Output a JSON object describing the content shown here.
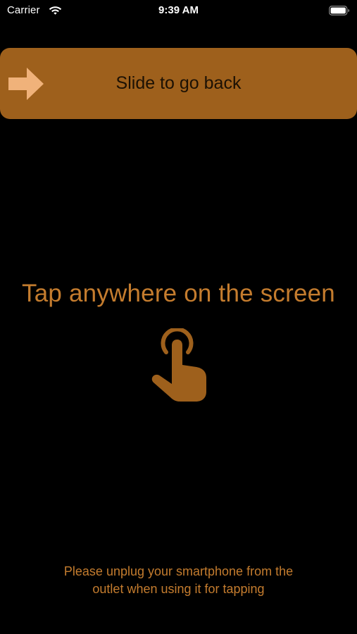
{
  "status_bar": {
    "carrier": "Carrier",
    "time": "9:39 AM",
    "wifi_icon": "wifi-icon",
    "battery_icon": "battery-full-icon"
  },
  "slide": {
    "label": "Slide to go back",
    "icon": "arrow-right-icon"
  },
  "main": {
    "title": "Tap anywhere on the screen",
    "icon": "hand-tap-icon"
  },
  "notice": {
    "line1": "Please unplug your smartphone from the",
    "line2": "outlet when using it for tapping"
  },
  "colors": {
    "background": "#000000",
    "accent": "#9e601c",
    "accent_text": "#c47c2e",
    "arrow": "#f0b27a",
    "status_text": "#ffffff"
  }
}
